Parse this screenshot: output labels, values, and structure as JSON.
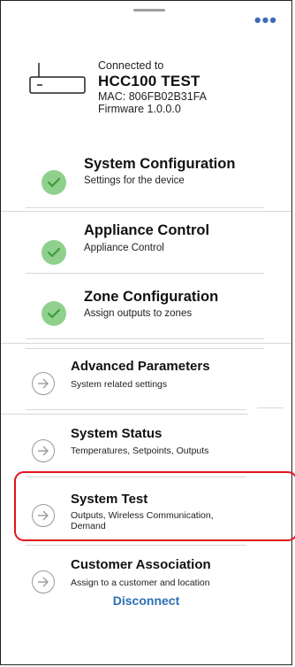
{
  "header": {
    "more_icon": "more-horizontal-icon",
    "accent": "#3b6bb5"
  },
  "device": {
    "connected_label": "Connected to",
    "name": "HCC100 TEST",
    "mac": "MAC: 806FB02B31FA",
    "firmware": "Firmware 1.0.0.0"
  },
  "menu": [
    {
      "title": "System Configuration",
      "subtitle": "Settings for the device",
      "status": "complete"
    },
    {
      "title": "Appliance Control",
      "subtitle": "Appliance Control",
      "status": "complete"
    },
    {
      "title": "Zone Configuration",
      "subtitle": "Assign outputs to zones",
      "status": "complete"
    },
    {
      "title": "Advanced Parameters",
      "subtitle": "System related settings",
      "status": "pending"
    },
    {
      "title": "System Status",
      "subtitle": "Temperatures, Setpoints, Outputs",
      "status": "pending"
    },
    {
      "title": "System Test",
      "subtitle_line1": "Outputs, Wireless Communication,",
      "subtitle_line2": "Demand",
      "status": "pending",
      "highlighted": true
    },
    {
      "title": "Customer Association",
      "subtitle": "Assign to a customer and location",
      "status": "pending"
    }
  ],
  "disconnect_label": "Disconnect",
  "colors": {
    "check_green": "#8fd18c",
    "highlight_red": "#e0151d",
    "link_blue": "#2b6fb3"
  }
}
